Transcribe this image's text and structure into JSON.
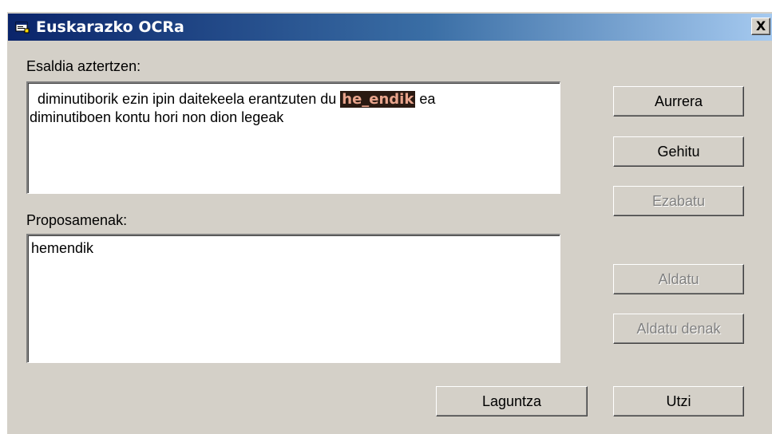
{
  "window": {
    "title": "Euskarazko OCRa",
    "close_label": "X"
  },
  "sentence_section": {
    "label": "Esaldia aztertzen:",
    "line1_before": "diminutiborik ezin ipin daitekeela erantzuten du",
    "highlighted_word": "he_endik",
    "line1_after": "ea",
    "line2": "diminutiboen kontu hori non dion legeak"
  },
  "proposals_section": {
    "label": "Proposamenak:",
    "items": [
      "hemendik"
    ]
  },
  "buttons": {
    "aurrera": "Aurrera",
    "gehitu": "Gehitu",
    "ezabatu": "Ezabatu",
    "aldatu": "Aldatu",
    "aldatu_denak": "Aldatu denak",
    "laguntza": "Laguntza",
    "utzi": "Utzi"
  },
  "icons": {
    "app": "app-window-icon",
    "close": "close-icon"
  },
  "colors": {
    "titlebar_start": "#0a246a",
    "titlebar_end": "#a6caf0",
    "highlight_bg": "#2a1a12",
    "highlight_fg": "#e8a48c",
    "face": "#d4d0c8",
    "disabled_text": "#808080"
  }
}
